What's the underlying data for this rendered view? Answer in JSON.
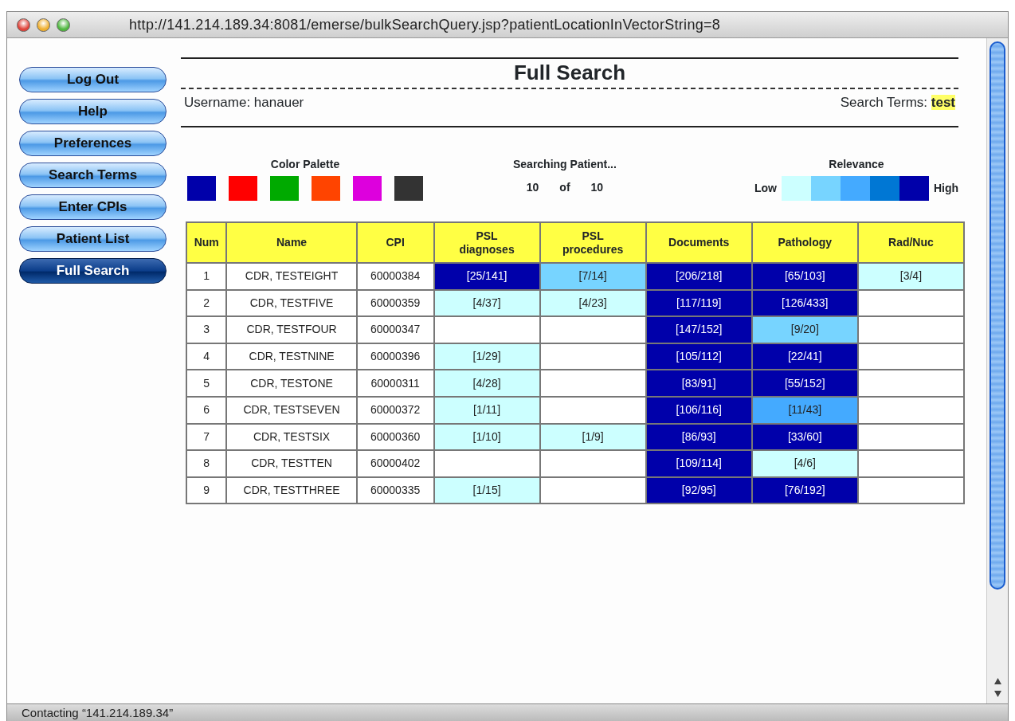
{
  "window": {
    "title": "http://141.214.189.34:8081/emerse/bulkSearchQuery.jsp?patientLocationInVectorString=8"
  },
  "sidebar": {
    "items": [
      {
        "label": "Log Out",
        "selected": false
      },
      {
        "label": "Help",
        "selected": false
      },
      {
        "label": "Preferences",
        "selected": false
      },
      {
        "label": "Search Terms",
        "selected": false
      },
      {
        "label": "Enter CPIs",
        "selected": false
      },
      {
        "label": "Patient List",
        "selected": false
      },
      {
        "label": "Full Search",
        "selected": true
      }
    ]
  },
  "page": {
    "title": "Full Search",
    "username_label": "Username: hanauer",
    "search_terms_label": "Search Terms:",
    "search_term": "test"
  },
  "color_palette": {
    "title": "Color Palette",
    "swatches": [
      {
        "color": "#0000aa"
      },
      {
        "color": "#ff0000"
      },
      {
        "color": "#00aa00"
      },
      {
        "color": "#ff4400"
      },
      {
        "color": "#dd00dd"
      },
      {
        "color": "#333333"
      }
    ]
  },
  "progress": {
    "title": "Searching Patient...",
    "current": "10",
    "of": "of",
    "total": "10"
  },
  "relevance": {
    "title": "Relevance",
    "low": "Low",
    "high": "High",
    "steps": [
      {
        "color": "#ccffff"
      },
      {
        "color": "#77d4ff"
      },
      {
        "color": "#44aaff"
      },
      {
        "color": "#0077d4"
      },
      {
        "color": "#0000aa"
      }
    ]
  },
  "table": {
    "columns": [
      "Num",
      "Name",
      "CPI",
      "PSL diagnoses",
      "PSL procedures",
      "Documents",
      "Pathology",
      "Rad/Nuc"
    ],
    "rows": [
      {
        "num": "1",
        "name": "CDR, TESTEIGHT",
        "cpi": "60000384",
        "psl_diagnoses": {
          "text": "[25/141]",
          "color": "#0000aa"
        },
        "psl_procedures": {
          "text": "[7/14]",
          "color": "#77d4ff"
        },
        "documents": {
          "text": "[206/218]",
          "color": "#0000aa"
        },
        "pathology": {
          "text": "[65/103]",
          "color": "#0000aa"
        },
        "rad_nuc": {
          "text": "[3/4]",
          "color": "#ccffff"
        }
      },
      {
        "num": "2",
        "name": "CDR, TESTFIVE",
        "cpi": "60000359",
        "psl_diagnoses": {
          "text": "[4/37]",
          "color": "#ccffff"
        },
        "psl_procedures": {
          "text": "[4/23]",
          "color": "#ccffff"
        },
        "documents": {
          "text": "[117/119]",
          "color": "#0000aa"
        },
        "pathology": {
          "text": "[126/433]",
          "color": "#0000aa"
        }
      },
      {
        "num": "3",
        "name": "CDR, TESTFOUR",
        "cpi": "60000347",
        "documents": {
          "text": "[147/152]",
          "color": "#0000aa"
        },
        "pathology": {
          "text": "[9/20]",
          "color": "#77d4ff"
        }
      },
      {
        "num": "4",
        "name": "CDR, TESTNINE",
        "cpi": "60000396",
        "psl_diagnoses": {
          "text": "[1/29]",
          "color": "#ccffff"
        },
        "documents": {
          "text": "[105/112]",
          "color": "#0000aa"
        },
        "pathology": {
          "text": "[22/41]",
          "color": "#0000aa"
        }
      },
      {
        "num": "5",
        "name": "CDR, TESTONE",
        "cpi": "60000311",
        "psl_diagnoses": {
          "text": "[4/28]",
          "color": "#ccffff"
        },
        "documents": {
          "text": "[83/91]",
          "color": "#0000aa"
        },
        "pathology": {
          "text": "[55/152]",
          "color": "#0000aa"
        }
      },
      {
        "num": "6",
        "name": "CDR, TESTSEVEN",
        "cpi": "60000372",
        "psl_diagnoses": {
          "text": "[1/11]",
          "color": "#ccffff"
        },
        "documents": {
          "text": "[106/116]",
          "color": "#0000aa"
        },
        "pathology": {
          "text": "[11/43]",
          "color": "#44aaff"
        }
      },
      {
        "num": "7",
        "name": "CDR, TESTSIX",
        "cpi": "60000360",
        "psl_diagnoses": {
          "text": "[1/10]",
          "color": "#ccffff"
        },
        "psl_procedures": {
          "text": "[1/9]",
          "color": "#ccffff"
        },
        "documents": {
          "text": "[86/93]",
          "color": "#0000aa"
        },
        "pathology": {
          "text": "[33/60]",
          "color": "#0000aa"
        }
      },
      {
        "num": "8",
        "name": "CDR, TESTTEN",
        "cpi": "60000402",
        "documents": {
          "text": "[109/114]",
          "color": "#0000aa"
        },
        "pathology": {
          "text": "[4/6]",
          "color": "#ccffff"
        }
      },
      {
        "num": "9",
        "name": "CDR, TESTTHREE",
        "cpi": "60000335",
        "psl_diagnoses": {
          "text": "[1/15]",
          "color": "#ccffff"
        },
        "documents": {
          "text": "[92/95]",
          "color": "#0000aa"
        },
        "pathology": {
          "text": "[76/192]",
          "color": "#0000aa"
        }
      }
    ]
  },
  "status_bar": {
    "text": "Contacting “141.214.189.34”"
  }
}
